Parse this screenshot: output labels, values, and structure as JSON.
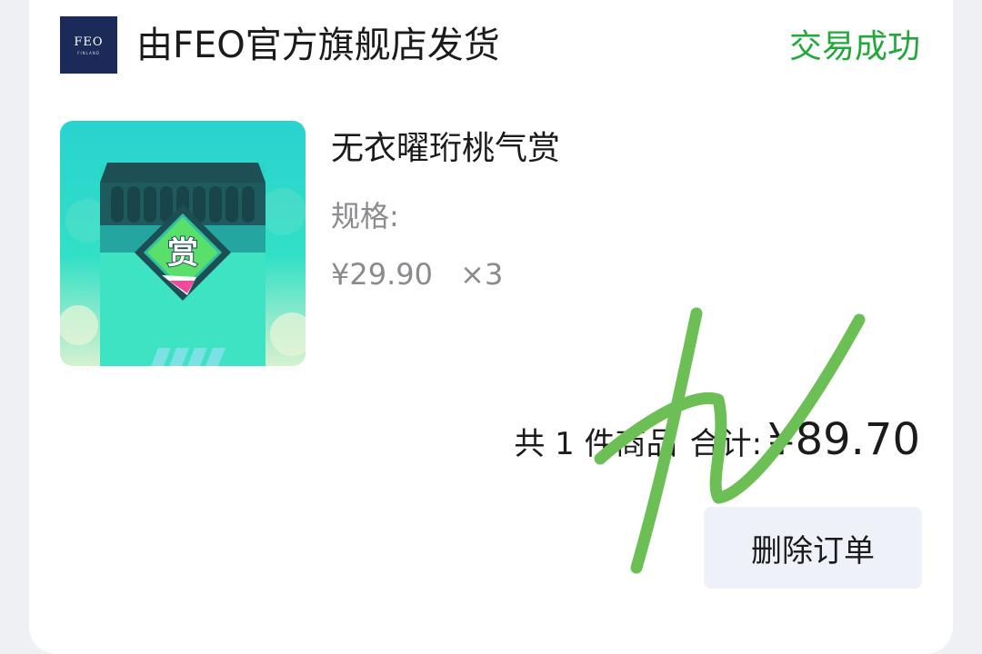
{
  "store": {
    "logo_text": "FEO",
    "logo_subtext": "FINLAND",
    "name": "由FEO官方旗舰店发货"
  },
  "order_status": "交易成功",
  "status_color": "#20a83a",
  "product": {
    "title": "无衣曜珩桃气赏",
    "spec_label": "规格:",
    "price": "¥29.90",
    "quantity": "×3",
    "thumbnail_badge": "赏"
  },
  "summary": {
    "count_text": "共 1 件商品",
    "total_label": "合计:",
    "total_value": "¥89.70"
  },
  "actions": {
    "delete_label": "删除订单"
  }
}
